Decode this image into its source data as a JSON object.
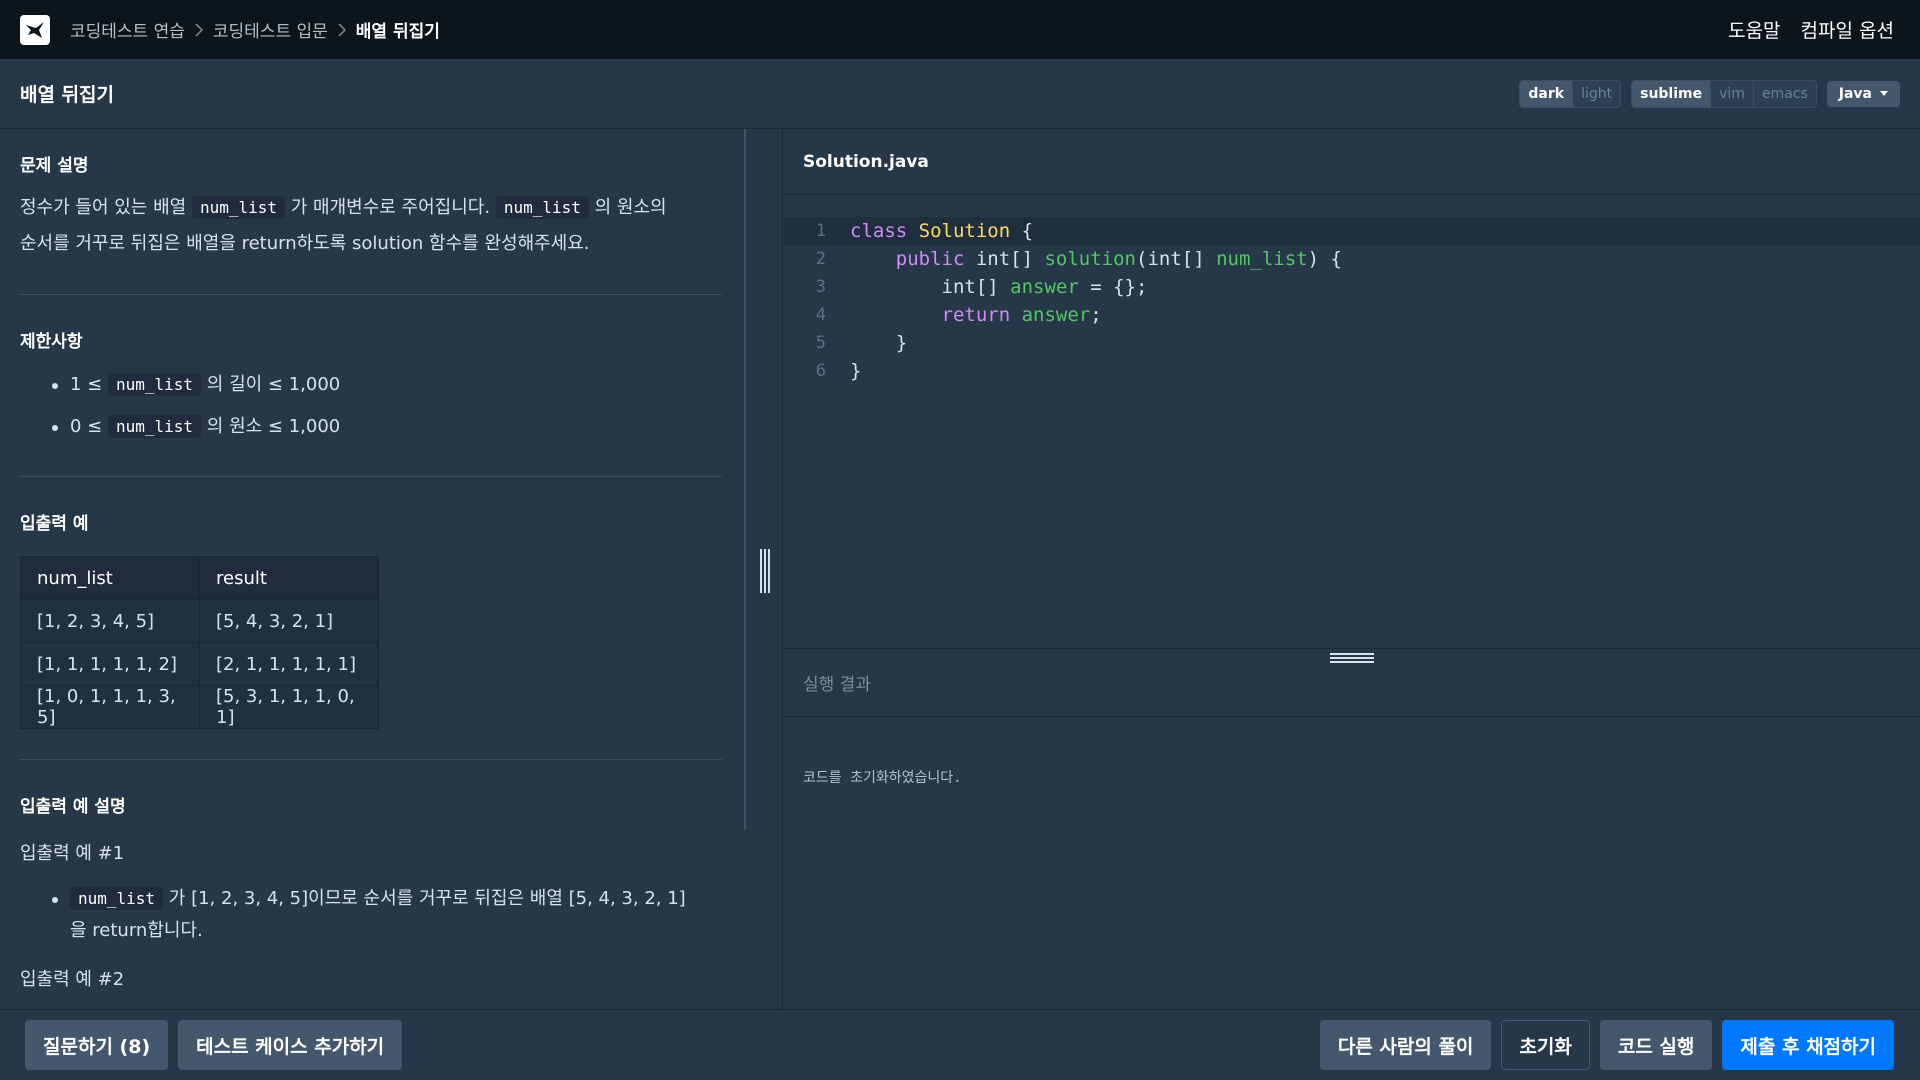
{
  "nav": {
    "breadcrumb": [
      "코딩테스트 연습",
      "코딩테스트 입문",
      "배열 뒤집기"
    ],
    "help": "도움말",
    "compile_options": "컴파일 옵션"
  },
  "titlebar": {
    "title": "배열 뒤집기",
    "themes": [
      "dark",
      "light"
    ],
    "active_theme": "dark",
    "keymaps": [
      "sublime",
      "vim",
      "emacs"
    ],
    "active_keymap": "sublime",
    "language": "Java"
  },
  "problem": {
    "desc_title": "문제 설명",
    "desc_part1": "정수가 들어 있는 배열",
    "desc_code1": "num_list",
    "desc_part2": "가 매개변수로 주어집니다.",
    "desc_code2": "num_list",
    "desc_part3": "의 원소의",
    "desc_line2": "순서를 거꾸로 뒤집은 배열을 return하도록 solution 함수를 완성해주세요.",
    "constraints_title": "제한사항",
    "constraints": [
      {
        "pre": "1 ≤",
        "code": "num_list",
        "post": "의 길이 ≤ 1,000"
      },
      {
        "pre": "0 ≤",
        "code": "num_list",
        "post": "의 원소 ≤ 1,000"
      }
    ],
    "io_title": "입출력 예",
    "io_headers": [
      "num_list",
      "result"
    ],
    "io_rows": [
      [
        "[1, 2, 3, 4, 5]",
        "[5, 4, 3, 2, 1]"
      ],
      [
        "[1, 1, 1, 1, 1, 2]",
        "[2, 1, 1, 1, 1, 1]"
      ],
      [
        "[1, 0, 1, 1, 1, 3, 5]",
        "[5, 3, 1, 1, 1, 0, 1]"
      ]
    ],
    "io_explain_title": "입출력 예 설명",
    "ex1_label": "입출력 예 #1",
    "ex1_code": "num_list",
    "ex1_text1": "가 [1, 2, 3, 4, 5]이므로 순서를 거꾸로 뒤집은 배열 [5, 4, 3, 2, 1]",
    "ex1_text2": "을 return합니다.",
    "ex2_label": "입출력 예 #2"
  },
  "editor": {
    "filename": "Solution.java",
    "line_numbers": [
      "1",
      "2",
      "3",
      "4",
      "5",
      "6"
    ]
  },
  "result": {
    "title": "실행 결과",
    "message": "코드를 초기화하였습니다."
  },
  "footer": {
    "ask": "질문하기 (8)",
    "add_test": "테스트 케이스 추가하기",
    "others": "다른 사람의 풀이",
    "reset": "초기화",
    "run": "코드 실행",
    "submit": "제출 후 채점하기"
  }
}
